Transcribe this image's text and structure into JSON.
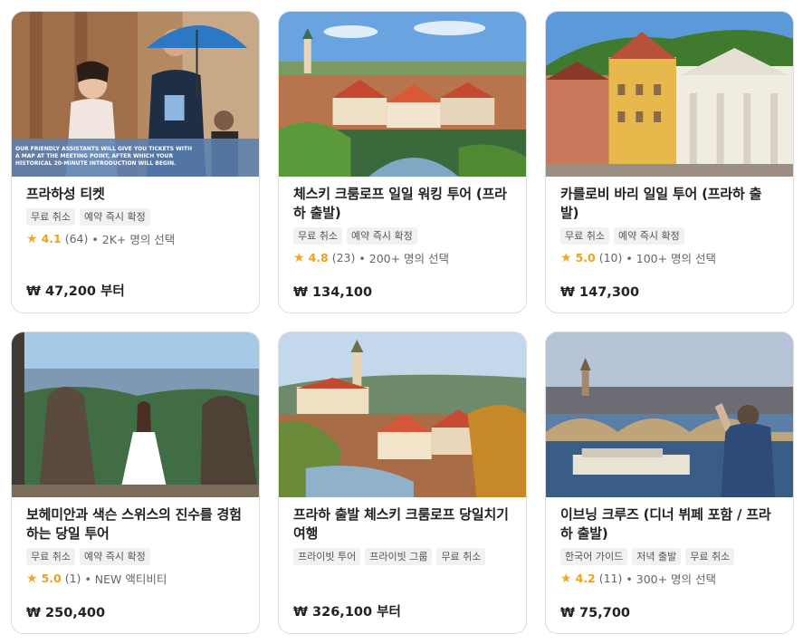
{
  "cards": [
    {
      "title": "프라하성 티켓",
      "tags": [
        "무료 취소",
        "예약 즉시 확정"
      ],
      "rating": {
        "score": "4.1",
        "count": "(64)",
        "extra": "• 2K+ 명의 선택"
      },
      "price": "₩ 47,200 부터",
      "photo_caption": "OUR FRIENDLY ASSISTANTS WILL GIVE YOU TICKETS WITH A MAP AT THE MEETING POINT, AFTER WHICH YOUR HISTORICAL 20-MINUTE INTRODUCTION WILL BEGIN."
    },
    {
      "title": "체스키 크룸로프 일일 워킹 투어 (프라하 출발)",
      "tags": [
        "무료 취소",
        "예약 즉시 확정"
      ],
      "rating": {
        "score": "4.8",
        "count": "(23)",
        "extra": "• 200+ 명의 선택"
      },
      "price": "₩ 134,100"
    },
    {
      "title": "카를로비 바리 일일 투어 (프라하 출발)",
      "tags": [
        "무료 취소",
        "예약 즉시 확정"
      ],
      "rating": {
        "score": "5.0",
        "count": "(10)",
        "extra": "• 100+ 명의 선택"
      },
      "price": "₩ 147,300"
    },
    {
      "title": "보헤미안과 색슨 스위스의 진수를 경험하는 당일 투어",
      "tags": [
        "무료 취소",
        "예약 즉시 확정"
      ],
      "rating": {
        "score": "5.0",
        "count": "(1)",
        "extra": "• NEW 액티비티"
      },
      "price": "₩ 250,400"
    },
    {
      "title": "프라하 출발 체스키 크룸로프 당일치기 여행",
      "tags": [
        "프라이빗 투어",
        "프라이빗 그룹",
        "무료 취소"
      ],
      "rating": null,
      "price": "₩ 326,100 부터"
    },
    {
      "title": "이브닝 크루즈 (디너 뷔페 포함 / 프라하 출발)",
      "tags": [
        "한국어 가이드",
        "저녁 출발",
        "무료 취소"
      ],
      "rating": {
        "score": "4.2",
        "count": "(11)",
        "extra": "• 300+ 명의 선택"
      },
      "price": "₩ 75,700"
    }
  ],
  "colors": {
    "star": "#f5a623",
    "score": "#f0a11b",
    "tag_bg": "#f1f1f1",
    "border": "#dcdcdc"
  },
  "icons": {
    "rating": "star-icon"
  }
}
